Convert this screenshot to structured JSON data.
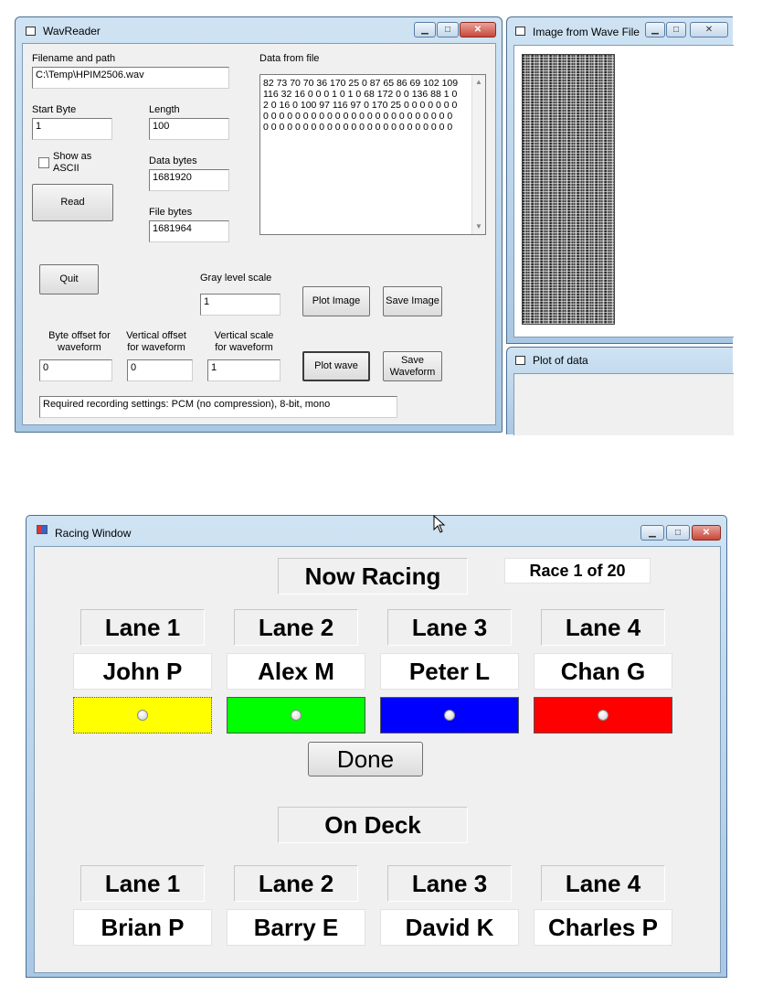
{
  "wavreader": {
    "title": "WavReader",
    "controls": {
      "minimize": "▁",
      "maximize": "□",
      "close": "✕"
    },
    "filename_label": "Filename and path",
    "filename_value": "C:\\Temp\\HPIM2506.wav",
    "data_from_file_label": "Data from file",
    "data_from_file_text": "82 73 70 70 36 170 25 0 87 65 86 69 102 109\n116 32 16 0 0 0 1 0 1 0 68 172 0 0 136 88 1 0\n2 0 16 0 100 97 116 97 0 170 25 0 0 0 0 0 0 0\n0 0 0 0 0 0 0 0 0 0 0 0 0 0 0 0 0 0 0 0 0 0 0 0\n0 0 0 0 0 0 0 0 0 0 0 0 0 0 0 0 0 0 0 0 0 0 0 0",
    "start_byte_label": "Start Byte",
    "start_byte_value": "1",
    "length_label": "Length",
    "length_value": "100",
    "show_ascii_label": "Show as ASCII",
    "data_bytes_label": "Data bytes",
    "data_bytes_value": "1681920",
    "read_button": "Read",
    "file_bytes_label": "File bytes",
    "file_bytes_value": "1681964",
    "quit_button": "Quit",
    "gray_scale_label": "Gray level scale",
    "gray_scale_value": "1",
    "plot_image_button": "Plot Image",
    "save_image_button": "Save Image",
    "byte_offset_label": "Byte offset for waveform",
    "byte_offset_value": "0",
    "vertical_offset_label": "Vertical offset for waveform",
    "vertical_offset_value": "0",
    "vertical_scale_label": "Vertical scale for waveform",
    "vertical_scale_value": "1",
    "plot_wave_button": "Plot wave",
    "save_waveform_button": "Save Waveform",
    "status_text": "Required recording settings:  PCM (no compression), 8-bit, mono"
  },
  "image_window": {
    "title": "Image from Wave File",
    "controls": {
      "minimize": "▁",
      "maximize": "□",
      "close": "✕"
    }
  },
  "plot_window": {
    "title": "Plot of data"
  },
  "racing": {
    "title": "Racing Window",
    "controls": {
      "minimize": "▁",
      "maximize": "□",
      "close": "✕"
    },
    "now_racing": "Now Racing",
    "race_counter": "Race 1 of 20",
    "done_button": "Done",
    "on_deck": "On Deck",
    "now_lanes": [
      {
        "lane": "Lane 1",
        "name": "John P",
        "color": "#ffff00"
      },
      {
        "lane": "Lane 2",
        "name": "Alex M",
        "color": "#00ff00"
      },
      {
        "lane": "Lane 3",
        "name": "Peter L",
        "color": "#0000ff"
      },
      {
        "lane": "Lane 4",
        "name": "Chan G",
        "color": "#ff0000"
      }
    ],
    "deck_lanes": [
      {
        "lane": "Lane 1",
        "name": "Brian P"
      },
      {
        "lane": "Lane 2",
        "name": "Barry E"
      },
      {
        "lane": "Lane 3",
        "name": "David K"
      },
      {
        "lane": "Lane 4",
        "name": "Charles P"
      }
    ]
  }
}
